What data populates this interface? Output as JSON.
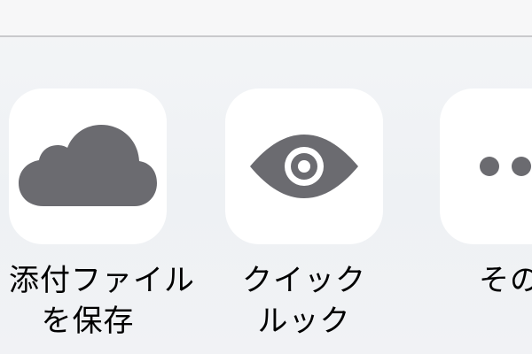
{
  "share_sheet": {
    "actions": [
      {
        "label_line1": "添付ファイル",
        "label_line2": "を保存",
        "icon": "cloud-icon",
        "icon_color": "#6b6b70"
      },
      {
        "label_line1": "クイック",
        "label_line2": "ルック",
        "icon": "eye-icon",
        "icon_color": "#6b6b70"
      },
      {
        "label_line1": "その",
        "label_line2": "",
        "icon": "more-icon",
        "icon_color": "#6b6b70"
      }
    ]
  }
}
